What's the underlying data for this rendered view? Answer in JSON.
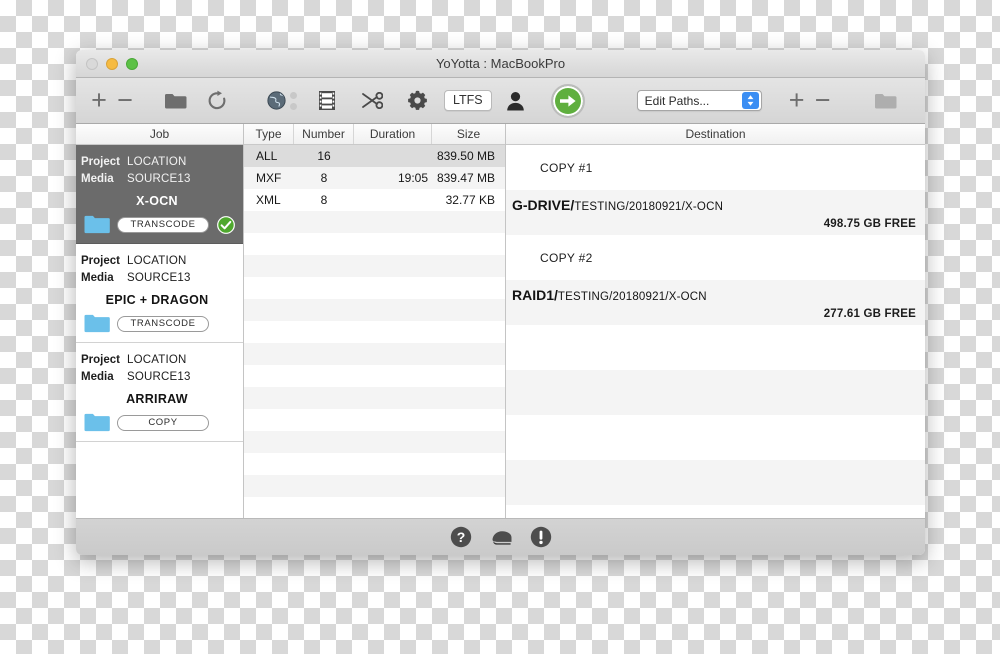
{
  "window": {
    "title": "YoYotta : MacBookPro",
    "traffic_lights": [
      "close",
      "minimize",
      "maximize"
    ]
  },
  "toolbar": {
    "add_label": "+",
    "remove_label": "−",
    "folder_icon": "folder-icon",
    "refresh_icon": "refresh-icon",
    "globe_icon": "globe-icon",
    "film_icon": "film-strip-icon",
    "scissors_icon": "scissors-icon",
    "gear_icon": "gear-icon",
    "ltfs_label": "LTFS",
    "user_icon": "user-icon",
    "go_icon": "arrow-right-icon",
    "edit_paths_label": "Edit Paths...",
    "dest_add_label": "+",
    "dest_remove_label": "−",
    "dest_folder_icon": "folder-icon"
  },
  "columns": {
    "job_header": "Job",
    "detail_headers": [
      "Type",
      "Number",
      "Duration",
      "Size"
    ],
    "destination_header": "Destination"
  },
  "jobs": [
    {
      "project_key": "Project",
      "project_value": "LOCATION",
      "media_key": "Media",
      "media_value": "SOURCE13",
      "title": "X-OCN",
      "action": "TRANSCODE",
      "selected": true,
      "status": "complete"
    },
    {
      "project_key": "Project",
      "project_value": "LOCATION",
      "media_key": "Media",
      "media_value": "SOURCE13",
      "title": "EPIC + DRAGON",
      "action": "TRANSCODE",
      "selected": false,
      "status": "none"
    },
    {
      "project_key": "Project",
      "project_value": "LOCATION",
      "media_key": "Media",
      "media_value": "SOURCE13",
      "title": "ARRIRAW",
      "action": "COPY",
      "selected": false,
      "status": "none"
    }
  ],
  "detail_rows": [
    {
      "type": "ALL",
      "number": "16",
      "duration": "",
      "size": "839.50 MB",
      "highlight": true
    },
    {
      "type": "MXF",
      "number": "8",
      "duration": "19:05",
      "size": "839.47 MB",
      "highlight": false
    },
    {
      "type": "XML",
      "number": "8",
      "duration": "",
      "size": "32.77 KB",
      "highlight": false
    }
  ],
  "destinations": [
    {
      "label": "COPY #1",
      "volume": "G-DRIVE/",
      "path": "TESTING/20180921/X-OCN",
      "free": "498.75 GB FREE"
    },
    {
      "label": "COPY #2",
      "volume": "RAID1/",
      "path": "TESTING/20180921/X-OCN",
      "free": "277.61 GB FREE"
    }
  ],
  "statusbar": {
    "help_icon": "question-mark-icon",
    "manual_icon": "book-icon",
    "alert_icon": "exclamation-mark-icon"
  },
  "colors": {
    "accent_green": "#5faf3e",
    "selected_row": "#6b6b6b",
    "folder_blue": "#6bc0ea",
    "popup_blue": "#3b8ef3"
  }
}
